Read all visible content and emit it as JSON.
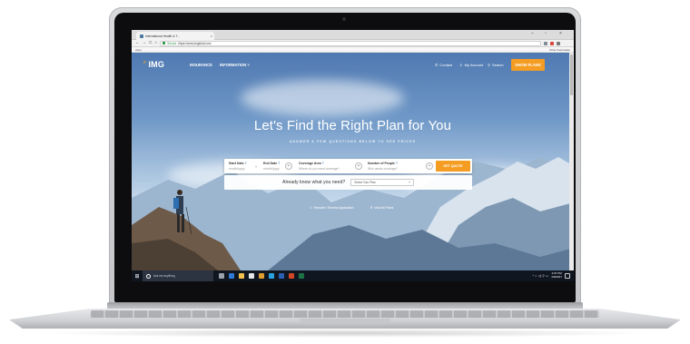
{
  "browser": {
    "tab_title": "International Health & T...",
    "tab_close": "×",
    "window_controls": [
      "–",
      "▫",
      "×"
    ],
    "nav_buttons": [
      "←",
      "→",
      "C",
      "⌂"
    ],
    "secure_label": "Secure",
    "url": "https://www.imglobal.com",
    "bookmarks_left": "Apps",
    "bookmarks_right": "Other bookmarks"
  },
  "site": {
    "logo": "IMG",
    "nav": {
      "insurance": "INSURANCE",
      "information": "INFORMATION ˅",
      "contact": "Contact",
      "account": "My Account",
      "search": "Search",
      "show_plans": "SHOW PLANS"
    },
    "hero": {
      "title": "Let's Find the Right Plan for You",
      "subtitle": "ANSWER A FEW QUESTIONS BELOW TO SEE PRICES"
    },
    "form": {
      "start_label": "Start Date",
      "start_ph": "mm/dd/yyyy",
      "end_label": "End Date",
      "end_ph": "mm/dd/yyyy",
      "area_label": "Coverage Area",
      "area_ph": "Where do you need coverage?",
      "people_label": "Number of People",
      "people_ph": "Who needs coverage?",
      "help_icon": "?",
      "plus": "+",
      "caret": "˅",
      "submit": "GET QUOTE"
    },
    "know": {
      "label": "Already know what you need?",
      "select_value": "Select Your Plan",
      "chevron": "˅"
    },
    "links": [
      {
        "icon": "□",
        "label": "Resume / Review Application"
      },
      {
        "icon": "≡",
        "label": "View All Plans"
      }
    ]
  },
  "taskbar": {
    "start_icon": "⊞",
    "search_placeholder": "Ask me anything",
    "apps": [
      {
        "name": "task-view",
        "color": "#9aa3ad"
      },
      {
        "name": "edge",
        "color": "#2f7bd6"
      },
      {
        "name": "explorer",
        "color": "#f2c14e"
      },
      {
        "name": "store",
        "color": "#e8e8e8"
      },
      {
        "name": "chrome",
        "color": "#e0a030"
      },
      {
        "name": "skype",
        "color": "#2aa3e0"
      },
      {
        "name": "word",
        "color": "#2b5fb3"
      },
      {
        "name": "powerpoint",
        "color": "#d24726"
      },
      {
        "name": "excel",
        "color": "#1e7145"
      }
    ],
    "tray_icons": "^ ⌂ ◁) ⚲ ▭",
    "time": "2:07 PM",
    "date": "2/9/2017"
  },
  "colors": {
    "accent": "#f59c22",
    "link_blue": "#3d86c6"
  }
}
